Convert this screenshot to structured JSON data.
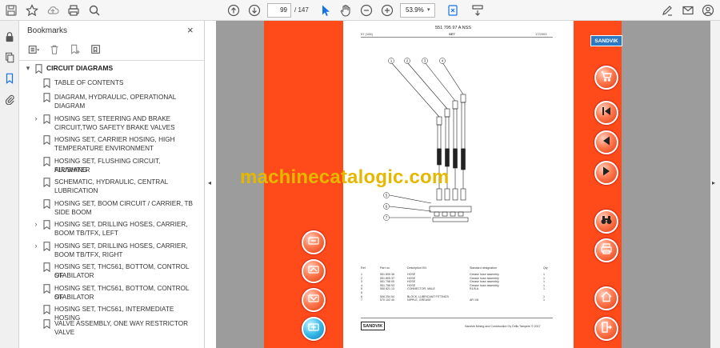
{
  "toolbar": {
    "page_current": "99",
    "page_total": "/ 147",
    "zoom": "53.9%"
  },
  "bookmarks": {
    "header": "Bookmarks",
    "close": "×",
    "items": [
      {
        "label": "CIRCUIT DIAGRAMS",
        "level": 0,
        "expander": "▾",
        "lines": [
          "CIRCUIT DIAGRAMS"
        ]
      },
      {
        "label": "TABLE OF CONTENTS",
        "level": 1,
        "expander": "",
        "lines": [
          "TABLE OF CONTENTS"
        ]
      },
      {
        "label": "DIAGRAM, HYDRAULIC, OPERATIONAL DIAGRAM",
        "level": 1,
        "expander": "",
        "lines": [
          "DIAGRAM, HYDRAULIC, OPERATIONAL",
          "DIAGRAM"
        ]
      },
      {
        "label": "HOSING SET, STEERING AND BRAKE CIRCUIT,TWO SAFETY BRAKE VALVES",
        "level": 1,
        "expander": "›",
        "lines": [
          "HOSING SET, STEERING AND BRAKE",
          "CIRCUIT,TWO SAFETY BRAKE VALVES"
        ]
      },
      {
        "label": "HOSING SET, CARRIER HOSING, HIGH TEMPERATURE ENVIRONMENT",
        "level": 1,
        "expander": "",
        "lines": [
          "HOSING SET, CARRIER HOSING, HIGH",
          "TEMPERATURE ENVIRONMENT"
        ]
      },
      {
        "label": "HOSING SET, FLUSHING CIRCUIT, AIR/WATER FLUSHING",
        "level": 1,
        "expander": "",
        "lines": [
          "HOSING SET, FLUSHING CIRCUIT, AIR/WATER",
          "FLUSHING"
        ]
      },
      {
        "label": "SCHEMATIC, HYDRAULIC, CENTRAL LUBRICATION",
        "level": 1,
        "expander": "",
        "lines": [
          "SCHEMATIC, HYDRAULIC, CENTRAL",
          "LUBRICATION"
        ]
      },
      {
        "label": "HOSING SET, BOOM CIRCUIT / CARRIER, TB SIDE BOOM",
        "level": 1,
        "expander": "",
        "lines": [
          "HOSING SET, BOOM CIRCUIT / CARRIER, TB",
          "SIDE BOOM"
        ]
      },
      {
        "label": "HOSING SET, DRILLING HOSES, CARRIER, BOOM TB/TFX, LEFT",
        "level": 1,
        "expander": "›",
        "lines": [
          "HOSING SET, DRILLING HOSES, CARRIER,",
          "BOOM TB/TFX, LEFT"
        ]
      },
      {
        "label": "HOSING SET, DRILLING HOSES, CARRIER, BOOM TB/TFX, RIGHT",
        "level": 1,
        "expander": "›",
        "lines": [
          "HOSING SET, DRILLING HOSES, CARRIER,",
          "BOOM TB/TFX, RIGHT"
        ]
      },
      {
        "label": "HOSING SET, THC561, BOTTOM, CONTROL OF STABILATOR",
        "level": 1,
        "expander": "",
        "lines": [
          "HOSING SET, THC561, BOTTOM, CONTROL OF",
          "STABILATOR"
        ]
      },
      {
        "label": "HOSING SET, THC561, BOTTOM, CONTROL OF STABILATOR",
        "level": 1,
        "expander": "",
        "lines": [
          "HOSING SET, THC561, BOTTOM, CONTROL OF",
          "STABILATOR"
        ]
      },
      {
        "label": "HOSING SET, THC561, INTERMEDIATE HOSING",
        "level": 1,
        "expander": "",
        "lines": [
          "HOSING SET, THC561, INTERMEDIATE HOSING"
        ]
      },
      {
        "label": "VALVE ASSEMBLY, ONE WAY RESTRICTOR VALVE",
        "level": 1,
        "expander": "",
        "lines": [
          "VALVE ASSEMBLY, ONE WAY RESTRICTOR",
          "VALVE"
        ]
      }
    ]
  },
  "document": {
    "brand_top": "SANDVIK",
    "watermark": "machinecatalogic.com",
    "page_title": "551 795 97 A NSS",
    "page_sub_left": "97 (106)",
    "page_sub_center": "SET",
    "page_sub_right": "17/2003",
    "table_headers": [
      "Ref.",
      "Part no.",
      "Description EN",
      "Standard designation",
      "Qty"
    ],
    "table_rows": [
      [
        "1",
        "551 805 36",
        "HOSE",
        "Grease hose assembly",
        "1"
      ],
      [
        "2",
        "551 805 37",
        "HOSE",
        "Grease hose assembly",
        "1"
      ],
      [
        "3",
        "551 758 05",
        "HOSE",
        "Grease hose assembly",
        "1"
      ],
      [
        "4",
        "551 758 53",
        "HOSE",
        "Grease hose assembly",
        "1"
      ],
      [
        "5",
        "550 821 13",
        "CONNECTOR, MALE",
        "R1/8-A",
        "1"
      ],
      [
        "6",
        "",
        "",
        "",
        ""
      ],
      [
        "6",
        "506 254 54",
        "BLOCK, LUBRICANT FITTINGS",
        "",
        "1"
      ],
      [
        "7",
        "570 102 40",
        "NIPPLE, GREASE",
        "AR 1/8",
        "1"
      ]
    ],
    "brand_bottom": "SANDVIK",
    "footer": "Sandvik Mining and Construction Oy Drills Tampere © 2017",
    "callouts": [
      "1",
      "2",
      "3",
      "4",
      "5",
      "6",
      "7"
    ],
    "colors": {
      "strip": "#ff4a1a",
      "button": "#ff6a3a",
      "brand_blue": "#2e79c4",
      "watermark": "#e5b800"
    }
  },
  "nav_buttons": {
    "left": [
      "layout-icon",
      "layout-icon",
      "layout-icon",
      "layout-icon"
    ],
    "right": [
      "cart-icon",
      "first-page-icon",
      "prev-page-icon",
      "next-page-icon",
      "search-icon",
      "print-icon",
      "home-icon",
      "exit-icon"
    ]
  }
}
